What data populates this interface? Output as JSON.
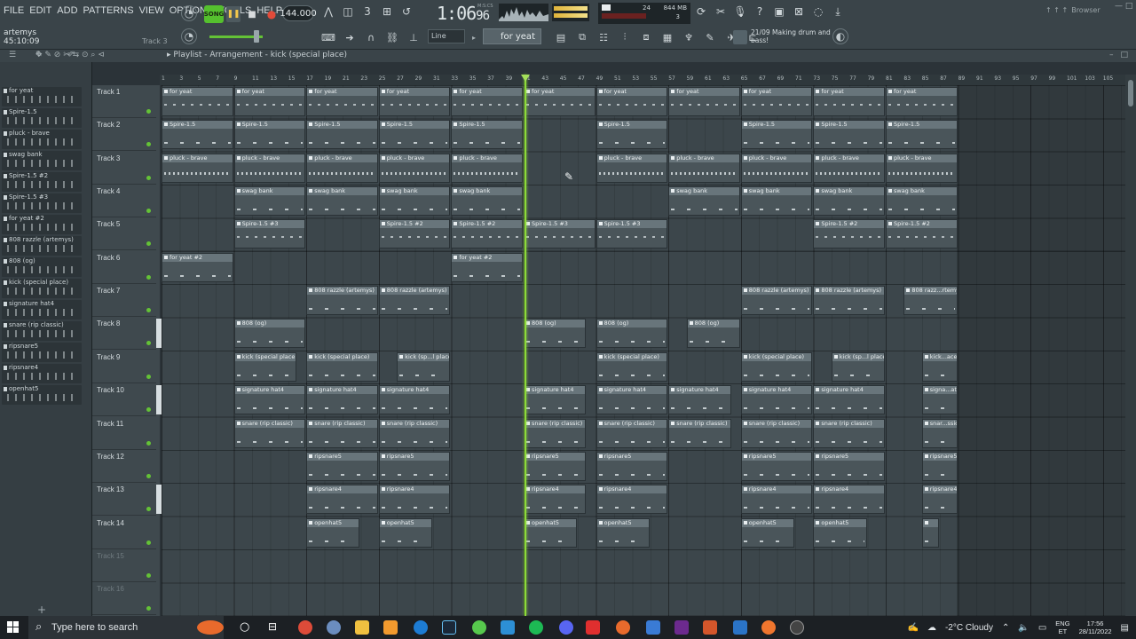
{
  "menu": [
    "FILE",
    "EDIT",
    "ADD",
    "PATTERNS",
    "VIEW",
    "OPTIONS",
    "TOOLS",
    "HELP"
  ],
  "song_info": {
    "title": "artemys",
    "time": "45:10:09",
    "hint": "Track 3"
  },
  "transport": {
    "mode": "SONG",
    "tempo": "144.000",
    "time": "1:06",
    "time_sub": "96",
    "time_unit": "M:S:CS"
  },
  "monitor": {
    "memory": "844 MB",
    "polyphony": "24",
    "cpu": "3"
  },
  "browser_label": "Browser",
  "snap": "Line",
  "pattern": "for yeat",
  "news": {
    "date": "21/09",
    "text": "Making drum and bass!"
  },
  "playlist": {
    "title": "Playlist - Arrangement - kick (special place)"
  },
  "picker_items": [
    "for yeat",
    "Spire-1.5",
    "pluck - brave",
    "swag bank",
    "Spire-1.5 #2",
    "Spire-1.5 #3",
    "for yeat #2",
    "808 razzle (artemys)",
    "808 (og)",
    "kick (special place)",
    "signature hat4",
    "snare (rip classic)",
    "ripsnare5",
    "ripsnare4",
    "openhat5"
  ],
  "bar_numbers": [
    "1",
    "3",
    "5",
    "7",
    "9",
    "11",
    "13",
    "15",
    "17",
    "19",
    "21",
    "23",
    "25",
    "27",
    "29",
    "31",
    "33",
    "35",
    "37",
    "39",
    "41",
    "43",
    "45",
    "47",
    "49",
    "51",
    "53",
    "55",
    "57",
    "59",
    "61",
    "63",
    "65",
    "67",
    "69",
    "71",
    "73",
    "75",
    "77",
    "79",
    "81",
    "83",
    "85",
    "87",
    "89",
    "91",
    "93",
    "95",
    "97",
    "99",
    "101",
    "103",
    "105"
  ],
  "tracks": [
    {
      "name": "Track 1",
      "clips": [
        {
          "label": "for yeat",
          "bar": 1,
          "len": 8,
          "style": "mid"
        },
        {
          "label": "for yeat",
          "bar": 9,
          "len": 8,
          "style": "mid"
        },
        {
          "label": "for yeat",
          "bar": 17,
          "len": 8,
          "style": "mid"
        },
        {
          "label": "for yeat",
          "bar": 25,
          "len": 8,
          "style": "mid"
        },
        {
          "label": "for yeat",
          "bar": 33,
          "len": 8,
          "style": "mid"
        },
        {
          "label": "for yeat",
          "bar": 41,
          "len": 8,
          "style": "mid"
        },
        {
          "label": "for yeat",
          "bar": 49,
          "len": 8,
          "style": "mid"
        },
        {
          "label": "for yeat",
          "bar": 57,
          "len": 8,
          "style": "mid"
        },
        {
          "label": "for yeat",
          "bar": 65,
          "len": 8,
          "style": "mid"
        },
        {
          "label": "for yeat",
          "bar": 73,
          "len": 8,
          "style": "mid"
        },
        {
          "label": "for yeat",
          "bar": 81,
          "len": 8,
          "style": "mid"
        }
      ]
    },
    {
      "name": "Track 2",
      "clips": [
        {
          "label": "Spire-1.5",
          "bar": 1,
          "len": 8,
          "style": "sparse"
        },
        {
          "label": "Spire-1.5",
          "bar": 9,
          "len": 8,
          "style": "sparse"
        },
        {
          "label": "Spire-1.5",
          "bar": 17,
          "len": 8,
          "style": "sparse"
        },
        {
          "label": "Spire-1.5",
          "bar": 25,
          "len": 8,
          "style": "sparse"
        },
        {
          "label": "Spire-1.5",
          "bar": 33,
          "len": 8,
          "style": "sparse"
        },
        {
          "label": "Spire-1.5",
          "bar": 49,
          "len": 8,
          "style": "sparse"
        },
        {
          "label": "Spire-1.5",
          "bar": 65,
          "len": 8,
          "style": "sparse"
        },
        {
          "label": "Spire-1.5",
          "bar": 73,
          "len": 8,
          "style": "sparse"
        },
        {
          "label": "Spire-1.5",
          "bar": 81,
          "len": 8,
          "style": "sparse"
        }
      ]
    },
    {
      "name": "Track 3",
      "clips": [
        {
          "label": "pluck - brave",
          "bar": 1,
          "len": 8,
          "style": "dense"
        },
        {
          "label": "pluck - brave",
          "bar": 9,
          "len": 8,
          "style": "dense"
        },
        {
          "label": "pluck - brave",
          "bar": 17,
          "len": 8,
          "style": "dense"
        },
        {
          "label": "pluck - brave",
          "bar": 25,
          "len": 8,
          "style": "dense"
        },
        {
          "label": "pluck - brave",
          "bar": 33,
          "len": 8,
          "style": "dense"
        },
        {
          "label": "pluck - brave",
          "bar": 49,
          "len": 8,
          "style": "dense"
        },
        {
          "label": "pluck - brave",
          "bar": 57,
          "len": 8,
          "style": "dense"
        },
        {
          "label": "pluck - brave",
          "bar": 65,
          "len": 8,
          "style": "dense"
        },
        {
          "label": "pluck - brave",
          "bar": 73,
          "len": 8,
          "style": "dense"
        },
        {
          "label": "pluck - brave",
          "bar": 81,
          "len": 8,
          "style": "dense"
        }
      ]
    },
    {
      "name": "Track 4",
      "clips": [
        {
          "label": "swag bank",
          "bar": 9,
          "len": 8,
          "style": "sparse"
        },
        {
          "label": "swag bank",
          "bar": 17,
          "len": 8,
          "style": "sparse"
        },
        {
          "label": "swag bank",
          "bar": 25,
          "len": 8,
          "style": "sparse"
        },
        {
          "label": "swag bank",
          "bar": 33,
          "len": 8,
          "style": "sparse"
        },
        {
          "label": "swag bank",
          "bar": 57,
          "len": 8,
          "style": "sparse"
        },
        {
          "label": "swag bank",
          "bar": 65,
          "len": 8,
          "style": "sparse"
        },
        {
          "label": "swag bank",
          "bar": 73,
          "len": 8,
          "style": "sparse"
        },
        {
          "label": "swag bank",
          "bar": 81,
          "len": 8,
          "style": "sparse"
        }
      ]
    },
    {
      "name": "Track 5",
      "clips": [
        {
          "label": "Spire-1.5 #3",
          "bar": 9,
          "len": 8,
          "style": "mid"
        },
        {
          "label": "Spire-1.5 #2",
          "bar": 25,
          "len": 8,
          "style": "mid"
        },
        {
          "label": "Spire-1.5 #2",
          "bar": 33,
          "len": 8,
          "style": "mid"
        },
        {
          "label": "Spire-1.5 #3",
          "bar": 41,
          "len": 8,
          "style": "mid"
        },
        {
          "label": "Spire-1.5 #3",
          "bar": 49,
          "len": 8,
          "style": "mid"
        },
        {
          "label": "Spire-1.5 #2",
          "bar": 73,
          "len": 8,
          "style": "mid"
        },
        {
          "label": "Spire-1.5 #2",
          "bar": 81,
          "len": 8,
          "style": "mid"
        }
      ]
    },
    {
      "name": "Track 6",
      "clips": [
        {
          "label": "for yeat #2",
          "bar": 1,
          "len": 8,
          "style": "sparse"
        },
        {
          "label": "for yeat #2",
          "bar": 33,
          "len": 8,
          "style": "sparse"
        }
      ]
    },
    {
      "name": "Track 7",
      "clips": [
        {
          "label": "808 razzle (artemys)",
          "bar": 17,
          "len": 8,
          "style": "sparse"
        },
        {
          "label": "808 razzle (artemys)",
          "bar": 25,
          "len": 8,
          "style": "sparse"
        },
        {
          "label": "808 razzle (artemys)",
          "bar": 65,
          "len": 8,
          "style": "sparse"
        },
        {
          "label": "808 razzle (artemys)",
          "bar": 73,
          "len": 8,
          "style": "sparse"
        },
        {
          "label": "808 razz...rtemys)",
          "bar": 83,
          "len": 6,
          "style": "sparse"
        }
      ]
    },
    {
      "name": "Track 8",
      "clips": [
        {
          "label": "808 (og)",
          "bar": 9,
          "len": 8,
          "style": "sparse"
        },
        {
          "label": "808 (og)",
          "bar": 41,
          "len": 7,
          "style": "sparse"
        },
        {
          "label": "808 (og)",
          "bar": 49,
          "len": 8,
          "style": "sparse"
        },
        {
          "label": "808 (og)",
          "bar": 59,
          "len": 6,
          "style": "sparse"
        }
      ]
    },
    {
      "name": "Track 9",
      "clips": [
        {
          "label": "kick (special place)",
          "bar": 9,
          "len": 7,
          "style": "sparse"
        },
        {
          "label": "kick (special place)",
          "bar": 17,
          "len": 8,
          "style": "sparse"
        },
        {
          "label": "kick (sp...l place)",
          "bar": 27,
          "len": 6,
          "style": "sparse"
        },
        {
          "label": "kick (special place)",
          "bar": 49,
          "len": 8,
          "style": "sparse"
        },
        {
          "label": "kick (special place)",
          "bar": 65,
          "len": 8,
          "style": "sparse"
        },
        {
          "label": "kick (sp...l place)",
          "bar": 75,
          "len": 6,
          "style": "sparse"
        },
        {
          "label": "kick...ace)",
          "bar": 85,
          "len": 4,
          "style": "sparse"
        }
      ]
    },
    {
      "name": "Track 10",
      "clips": [
        {
          "label": "signature hat4",
          "bar": 9,
          "len": 8,
          "style": "sparse"
        },
        {
          "label": "signature hat4",
          "bar": 17,
          "len": 8,
          "style": "sparse"
        },
        {
          "label": "signature hat4",
          "bar": 25,
          "len": 8,
          "style": "sparse"
        },
        {
          "label": "signature hat4",
          "bar": 41,
          "len": 7,
          "style": "sparse"
        },
        {
          "label": "signature hat4",
          "bar": 49,
          "len": 8,
          "style": "sparse"
        },
        {
          "label": "signature hat4",
          "bar": 57,
          "len": 7,
          "style": "sparse"
        },
        {
          "label": "signature hat4",
          "bar": 65,
          "len": 8,
          "style": "sparse"
        },
        {
          "label": "signature hat4",
          "bar": 73,
          "len": 8,
          "style": "sparse"
        },
        {
          "label": "signa...at4",
          "bar": 85,
          "len": 4,
          "style": "sparse"
        }
      ]
    },
    {
      "name": "Track 11",
      "clips": [
        {
          "label": "snare (rip classic)",
          "bar": 9,
          "len": 8,
          "style": "sparse"
        },
        {
          "label": "snare (rip classic)",
          "bar": 17,
          "len": 8,
          "style": "sparse"
        },
        {
          "label": "snare (rip classic)",
          "bar": 25,
          "len": 8,
          "style": "sparse"
        },
        {
          "label": "snare (rip classic)",
          "bar": 41,
          "len": 7,
          "style": "sparse"
        },
        {
          "label": "snare (rip classic)",
          "bar": 49,
          "len": 8,
          "style": "sparse"
        },
        {
          "label": "snare (rip classic)",
          "bar": 57,
          "len": 7,
          "style": "sparse"
        },
        {
          "label": "snare (rip classic)",
          "bar": 65,
          "len": 8,
          "style": "sparse"
        },
        {
          "label": "snare (rip classic)",
          "bar": 73,
          "len": 8,
          "style": "sparse"
        },
        {
          "label": "snar...ssic)",
          "bar": 85,
          "len": 4,
          "style": "sparse"
        }
      ]
    },
    {
      "name": "Track 12",
      "clips": [
        {
          "label": "ripsnare5",
          "bar": 17,
          "len": 8,
          "style": "sparse"
        },
        {
          "label": "ripsnare5",
          "bar": 25,
          "len": 8,
          "style": "sparse"
        },
        {
          "label": "ripsnare5",
          "bar": 41,
          "len": 7,
          "style": "sparse"
        },
        {
          "label": "ripsnare5",
          "bar": 49,
          "len": 8,
          "style": "sparse"
        },
        {
          "label": "ripsnare5",
          "bar": 65,
          "len": 8,
          "style": "sparse"
        },
        {
          "label": "ripsnare5",
          "bar": 73,
          "len": 8,
          "style": "sparse"
        },
        {
          "label": "ripsnare5",
          "bar": 85,
          "len": 4,
          "style": "sparse"
        }
      ]
    },
    {
      "name": "Track 13",
      "clips": [
        {
          "label": "ripsnare4",
          "bar": 17,
          "len": 8,
          "style": "sparse"
        },
        {
          "label": "ripsnare4",
          "bar": 25,
          "len": 8,
          "style": "sparse"
        },
        {
          "label": "ripsnare4",
          "bar": 41,
          "len": 7,
          "style": "sparse"
        },
        {
          "label": "ripsnare4",
          "bar": 49,
          "len": 8,
          "style": "sparse"
        },
        {
          "label": "ripsnare4",
          "bar": 65,
          "len": 8,
          "style": "sparse"
        },
        {
          "label": "ripsnare4",
          "bar": 73,
          "len": 8,
          "style": "sparse"
        },
        {
          "label": "ripsnare4",
          "bar": 85,
          "len": 4,
          "style": "sparse"
        }
      ]
    },
    {
      "name": "Track 14",
      "clips": [
        {
          "label": "openhat5",
          "bar": 17,
          "len": 6,
          "style": "sparse"
        },
        {
          "label": "openhat5",
          "bar": 25,
          "len": 6,
          "style": "sparse"
        },
        {
          "label": "openhat5",
          "bar": 41,
          "len": 6,
          "style": "sparse"
        },
        {
          "label": "openhat5",
          "bar": 49,
          "len": 6,
          "style": "sparse"
        },
        {
          "label": "openhat5",
          "bar": 65,
          "len": 6,
          "style": "sparse"
        },
        {
          "label": "openhat5",
          "bar": 73,
          "len": 6,
          "style": "sparse"
        },
        {
          "label": "",
          "bar": 85,
          "len": 2,
          "style": "sparse"
        }
      ]
    },
    {
      "name": "Track 15",
      "clips": []
    },
    {
      "name": "Track 16",
      "clips": []
    }
  ],
  "taskbar": {
    "search_placeholder": "Type here to search",
    "weather": "-2°C  Cloudy",
    "lang": "ENG",
    "lang_sub": "ET",
    "time": "17:56",
    "date": "28/11/2022"
  },
  "colors": {
    "accent": "#64c236",
    "playhead": "#8ddb3a",
    "clip_title": "#68757b",
    "grid": "#3c464b"
  }
}
